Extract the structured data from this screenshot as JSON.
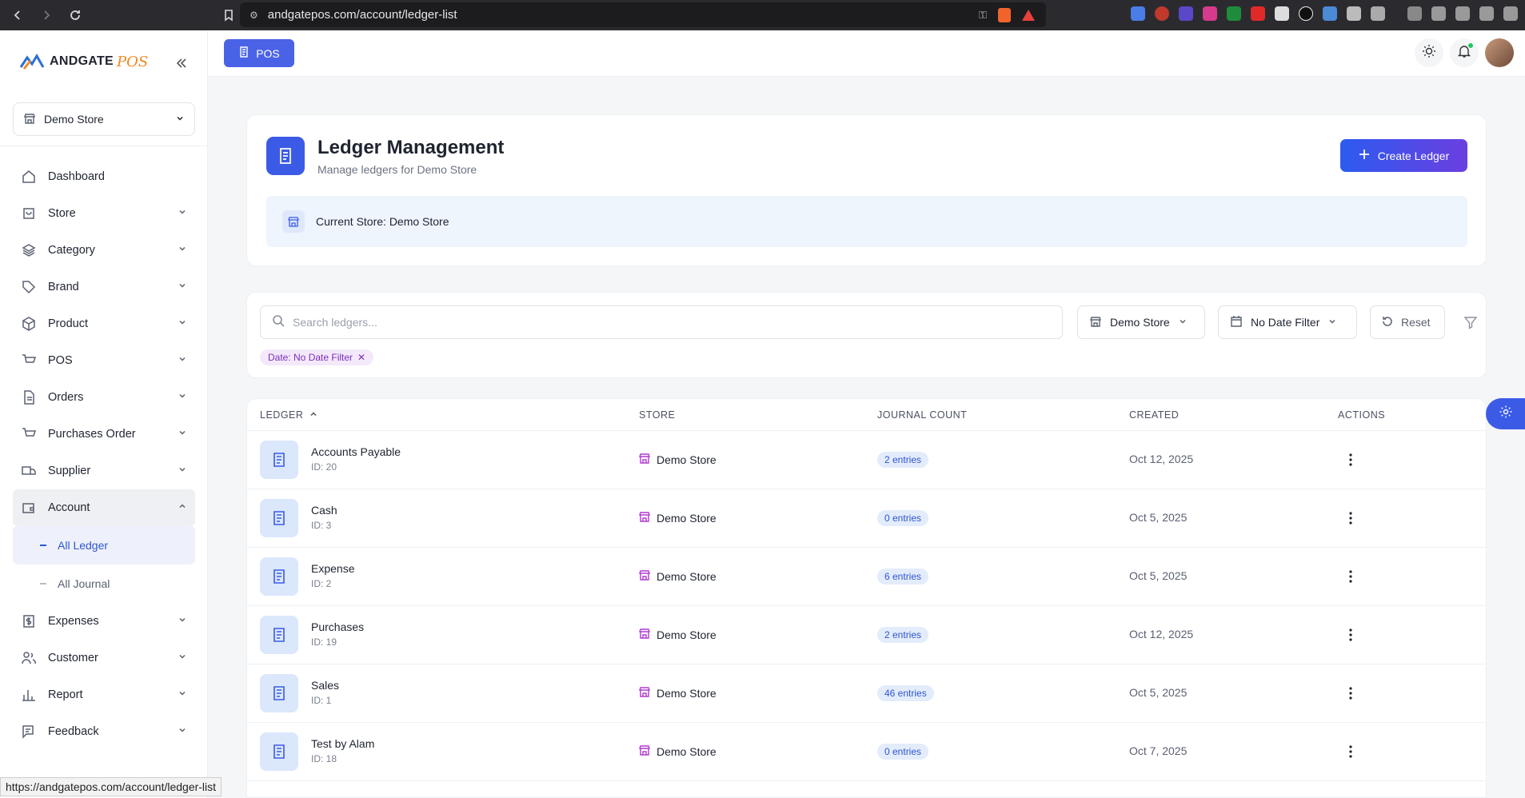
{
  "browser": {
    "url": "andgatepos.com/account/ledger-list",
    "status_url": "https://andgatepos.com/account/ledger-list"
  },
  "brand": {
    "name": "ANDGATE",
    "suffix": "POS",
    "accent": "#f08a24"
  },
  "sidebar": {
    "store_selector": "Demo Store",
    "items": [
      {
        "label": "Dashboard",
        "icon": "home-icon"
      },
      {
        "label": "Store",
        "icon": "store-icon"
      },
      {
        "label": "Category",
        "icon": "layers-icon"
      },
      {
        "label": "Brand",
        "icon": "tag-icon"
      },
      {
        "label": "Product",
        "icon": "box-icon"
      },
      {
        "label": "POS",
        "icon": "cart-icon"
      },
      {
        "label": "Orders",
        "icon": "document-icon"
      },
      {
        "label": "Purchases Order",
        "icon": "cart-icon"
      },
      {
        "label": "Supplier",
        "icon": "truck-icon"
      },
      {
        "label": "Account",
        "icon": "wallet-icon"
      },
      {
        "label": "Expenses",
        "icon": "dollar-icon"
      },
      {
        "label": "Customer",
        "icon": "users-icon"
      },
      {
        "label": "Report",
        "icon": "chart-icon"
      },
      {
        "label": "Feedback",
        "icon": "feedback-icon"
      }
    ],
    "account_sub": [
      {
        "label": "All Ledger"
      },
      {
        "label": "All Journal"
      }
    ]
  },
  "topbar": {
    "pos_label": "POS"
  },
  "header": {
    "title": "Ledger Management",
    "subtitle": "Manage ledgers for Demo Store",
    "create_label": "Create Ledger",
    "current_store": "Current Store: Demo Store"
  },
  "filters": {
    "search_placeholder": "Search ledgers...",
    "store": "Demo Store",
    "date": "No Date Filter",
    "reset": "Reset",
    "chip": "Date: No Date Filter"
  },
  "table": {
    "headers": {
      "ledger": "LEDGER",
      "store": "STORE",
      "journal": "JOURNAL COUNT",
      "created": "CREATED",
      "actions": "ACTIONS"
    },
    "rows": [
      {
        "name": "Accounts Payable",
        "id": "ID: 20",
        "store": "Demo Store",
        "entries": "2 entries",
        "created": "Oct 12, 2025"
      },
      {
        "name": "Cash",
        "id": "ID: 3",
        "store": "Demo Store",
        "entries": "0 entries",
        "created": "Oct 5, 2025"
      },
      {
        "name": "Expense",
        "id": "ID: 2",
        "store": "Demo Store",
        "entries": "6 entries",
        "created": "Oct 5, 2025"
      },
      {
        "name": "Purchases",
        "id": "ID: 19",
        "store": "Demo Store",
        "entries": "2 entries",
        "created": "Oct 12, 2025"
      },
      {
        "name": "Sales",
        "id": "ID: 1",
        "store": "Demo Store",
        "entries": "46 entries",
        "created": "Oct 5, 2025"
      },
      {
        "name": "Test by Alam",
        "id": "ID: 18",
        "store": "Demo Store",
        "entries": "0 entries",
        "created": "Oct 7, 2025"
      }
    ]
  },
  "colors": {
    "primary": "#3b5be7",
    "gradient_end": "#6b3fe0",
    "chip_bg": "#f4e9fb",
    "chip_text": "#7a2fb8"
  }
}
